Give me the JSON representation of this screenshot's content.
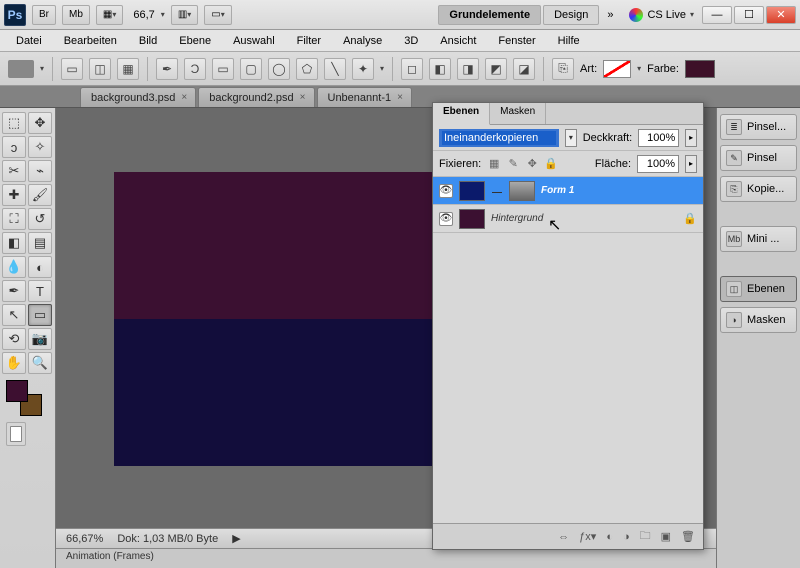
{
  "app": {
    "ps": "Ps",
    "br": "Br",
    "mb": "Mb"
  },
  "zoom_display": "66,7",
  "workspaces": {
    "active": "Grundelemente",
    "second": "Design",
    "more": "»"
  },
  "cslive": "CS Live",
  "menus": [
    "Datei",
    "Bearbeiten",
    "Bild",
    "Ebene",
    "Auswahl",
    "Filter",
    "Analyse",
    "3D",
    "Ansicht",
    "Fenster",
    "Hilfe"
  ],
  "options": {
    "art_label": "Art:",
    "farbe_label": "Farbe:"
  },
  "doc_tabs": [
    "background3.psd",
    "background2.psd",
    "Unbenannt-1"
  ],
  "tools": [
    [
      "move",
      "selection"
    ],
    [
      "lasso",
      "wand"
    ],
    [
      "crop",
      "eyedrop"
    ],
    [
      "patch",
      "brush"
    ],
    [
      "stamp",
      "history"
    ],
    [
      "eraser",
      "gradient"
    ],
    [
      "blur",
      "dodge"
    ],
    [
      "pen",
      "type"
    ],
    [
      "path",
      "shape"
    ],
    [
      "3d",
      "3dcam"
    ],
    [
      "hand",
      "zoom"
    ]
  ],
  "status": {
    "zoom": "66,67%",
    "doc": "Dok: 1,03 MB/0 Byte"
  },
  "animation_tab": "Animation (Frames)",
  "layers_panel": {
    "tabs": {
      "ebenen": "Ebenen",
      "masken": "Masken"
    },
    "blend_mode": "Ineinanderkopieren",
    "deckkraft_label": "Deckkraft:",
    "deckkraft_value": "100%",
    "fixieren_label": "Fixieren:",
    "flaeche_label": "Fläche:",
    "flaeche_value": "100%",
    "layers": [
      {
        "name": "Form 1",
        "selected": true
      },
      {
        "name": "Hintergrund",
        "locked": true
      }
    ]
  },
  "dock": {
    "pinsel_dots": "Pinsel...",
    "pinsel": "Pinsel",
    "kopie": "Kopie...",
    "mini": "Mini ...",
    "ebenen": "Ebenen",
    "masken": "Masken"
  }
}
